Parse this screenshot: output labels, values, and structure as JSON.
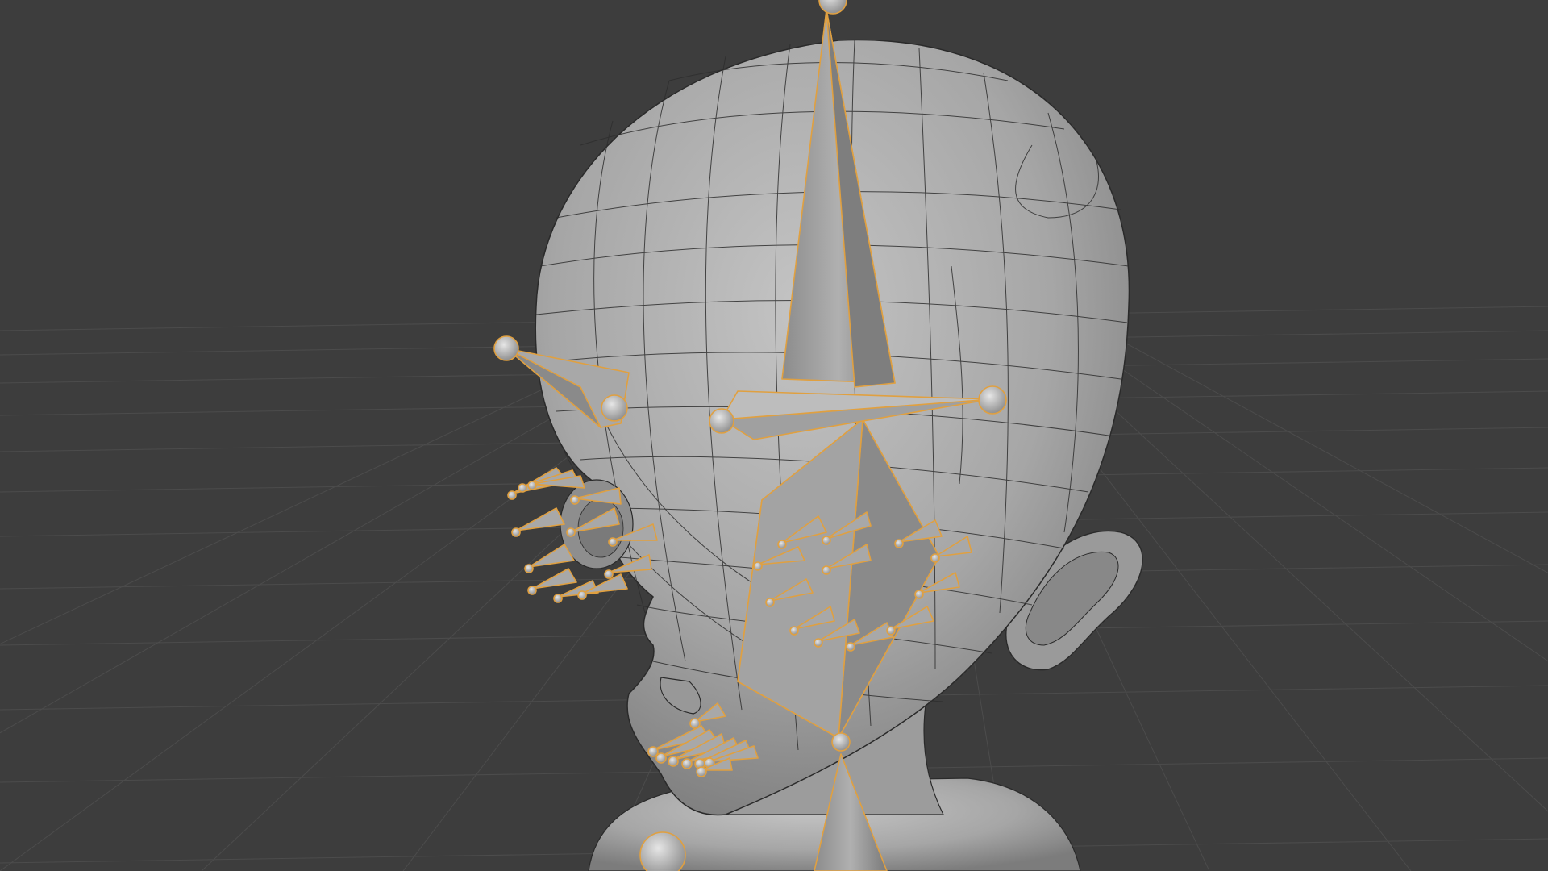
{
  "app": {
    "view": "3d-viewport",
    "object_name": "",
    "mode": ""
  },
  "viewport": {
    "background_color": "#3d3d3d",
    "grid_color": "#4a4a4a",
    "mesh_color": "#a9a9a9",
    "wire_color": "#2a2a2a",
    "bone_color": "#9a9a9a",
    "bone_outline_color": "#e0a040"
  },
  "scene": {
    "mesh": "head-mesh",
    "armature": "face-rig",
    "selected_bones_highlight": "orange"
  }
}
